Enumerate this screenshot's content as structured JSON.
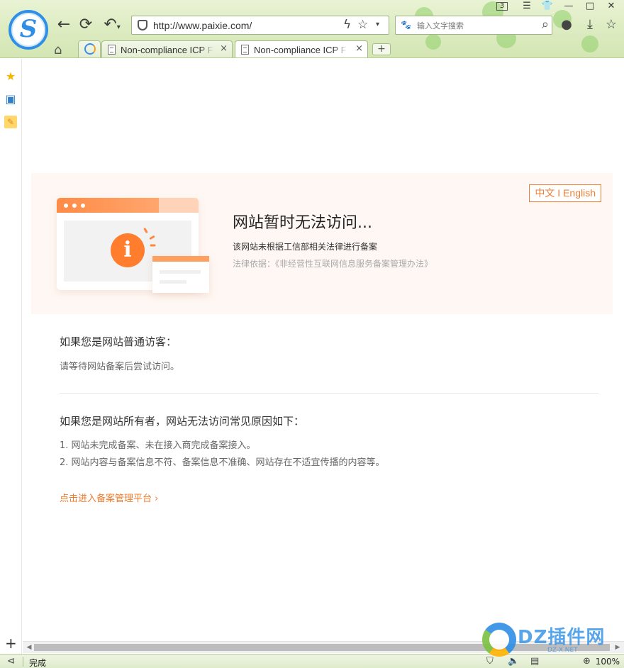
{
  "browser": {
    "url": "http://www.paixie.com/",
    "search_placeholder": "输入文字搜索",
    "badge_count": "3",
    "tabs": [
      {
        "title": "Non-compliance ICP Filing",
        "close": "×"
      },
      {
        "title": "Non-compliance ICP Filing",
        "close": "×"
      }
    ],
    "new_tab": "+",
    "accent": "#2f8fe6"
  },
  "page": {
    "lang_switch": "中文 I English",
    "heading": "网站暂时无法访问...",
    "description": "该网站未根据工信部相关法律进行备案",
    "law_basis": "法律依据：《非经营性互联网信息服务备案管理办法》",
    "visitor": {
      "title": "如果您是网站普通访客：",
      "text": "请等待网站备案后尝试访问。"
    },
    "owner": {
      "title": "如果您是网站所有者，网站无法访问常见原因如下：",
      "reasons": [
        "1. 网站未完成备案、未在接入商完成备案接入。",
        "2. 网站内容与备案信息不符、备案信息不准确、网站存在不适宜传播的内容等。"
      ]
    },
    "link": "点击进入备案管理平台 ›",
    "accent": "#ef7d35"
  },
  "status": {
    "text": "完成",
    "zoom": "100%"
  },
  "watermark": {
    "text": "DZ插件网",
    "sub": "DZ-X.NET"
  }
}
